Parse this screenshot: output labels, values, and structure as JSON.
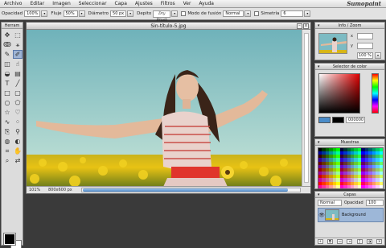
{
  "menu": [
    "Archivo",
    "Editar",
    "Imagen",
    "Seleccionar",
    "Capa",
    "Ajustes",
    "Filtros",
    "Ver",
    "Ayuda"
  ],
  "brand": "Sumopaint",
  "options": {
    "opacity_label": "Opacidad",
    "opacity_value": "100%",
    "flow_label": "Fluje",
    "flow_value": "50%",
    "diameter_label": "Diámetro",
    "diameter_value": "50 px",
    "brush_label": "Depito",
    "brush_name": "Dry Brush",
    "blend_label": "Modo de fusión",
    "blend_value": "Normal",
    "symmetry_label": "Simetría",
    "symmetry_value": "6"
  },
  "toolbox": {
    "title": "Herram"
  },
  "document": {
    "title": "Sin-título-5.jpg",
    "zoom": "101%",
    "size": "800x600 px",
    "close": "x"
  },
  "navigator": {
    "title": "Info / Zoom",
    "zoom": "100 %"
  },
  "color_picker": {
    "title": "Selector de color",
    "hex": "000000",
    "foreground": "#000000",
    "background": "#ffffff"
  },
  "swatches": {
    "title": "Muestras"
  },
  "layers": {
    "title": "Capas",
    "blend": "Normal",
    "opacity_label": "Opacidad",
    "opacity_value": "100",
    "items": [
      {
        "name": "Background"
      }
    ]
  },
  "colors": {
    "selection": "#9fb4d4",
    "hscroll": "#4f89c9",
    "sky": "#83c1c9",
    "field": "#e8c214"
  }
}
